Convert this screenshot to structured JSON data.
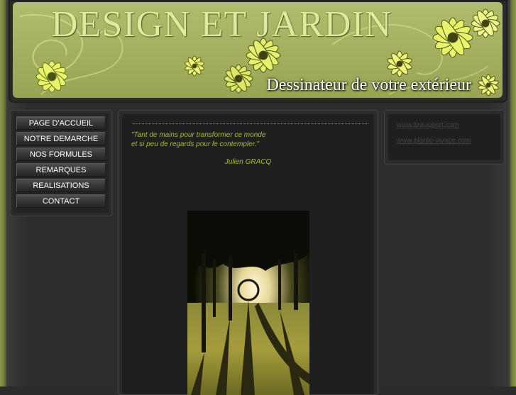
{
  "header": {
    "title": "DESIGN ET JARDIN",
    "subtitle": "Dessinateur de votre extérieur"
  },
  "nav": {
    "items": [
      {
        "label": "PAGE D'ACCUEIL"
      },
      {
        "label": "NOTRE DEMARCHE"
      },
      {
        "label": "NOS FORMULES"
      },
      {
        "label": "REMARQUES"
      },
      {
        "label": "REALISATIONS"
      },
      {
        "label": "CONTACT"
      }
    ]
  },
  "content": {
    "quote_line1": "\"Tant de mains pour transformer ce monde",
    "quote_line2": "et si peu de regards pour le contempler.\"",
    "author": "Julien GRACQ"
  },
  "links": {
    "items": [
      {
        "label": "www.bravoport.com"
      },
      {
        "label": "www.plante-vivace.com"
      }
    ]
  },
  "colors": {
    "banner": "#a6b161",
    "accent_text": "#a9ba3c",
    "background": "#2c2c2c"
  }
}
